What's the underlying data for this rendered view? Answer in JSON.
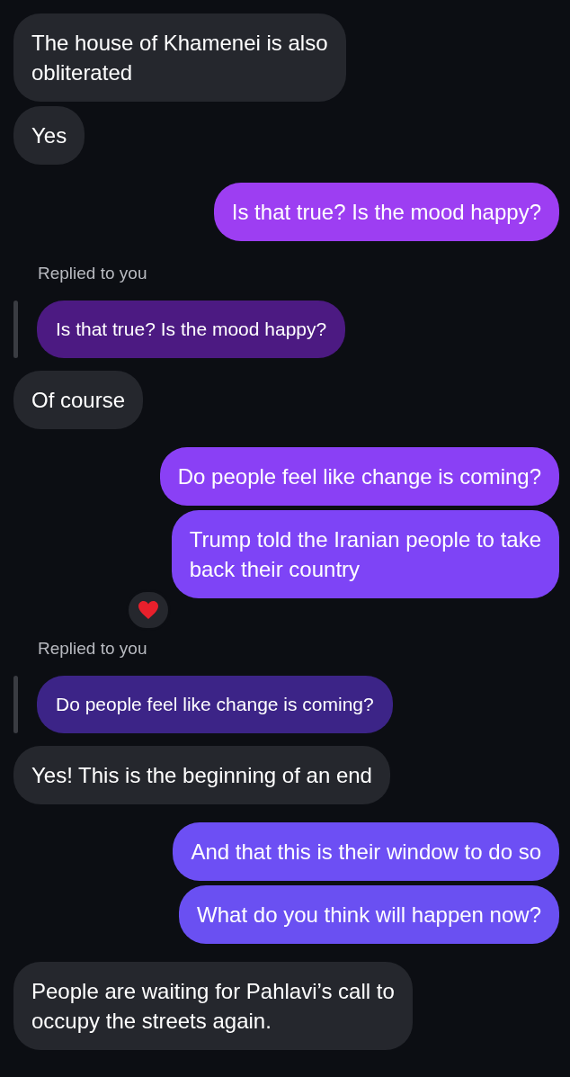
{
  "messages": [
    {
      "kind": "received",
      "text": "The house of Khamenei is also\nobliterated"
    },
    {
      "kind": "received",
      "text": "Yes"
    },
    {
      "kind": "sent",
      "text": "Is that true? Is the mood happy?"
    },
    {
      "kind": "reply",
      "label": "Replied to you",
      "text": "Is that true? Is the mood happy?"
    },
    {
      "kind": "received",
      "text": "Of course"
    },
    {
      "kind": "sent",
      "text": "Do people feel like change is coming?"
    },
    {
      "kind": "sent",
      "text": "Trump told the Iranian people to take\nback their country",
      "reaction": true
    },
    {
      "kind": "reply",
      "label": "Replied to you",
      "text": "Do people feel like change is coming?"
    },
    {
      "kind": "received",
      "text": "Yes! This is the beginning of an end"
    },
    {
      "kind": "sent",
      "text": "And that this is their window to do so"
    },
    {
      "kind": "sent",
      "text": "What do you think will happen now?"
    },
    {
      "kind": "received",
      "text": "People are waiting for Pahlavi’s call to\noccupy the streets again."
    }
  ]
}
